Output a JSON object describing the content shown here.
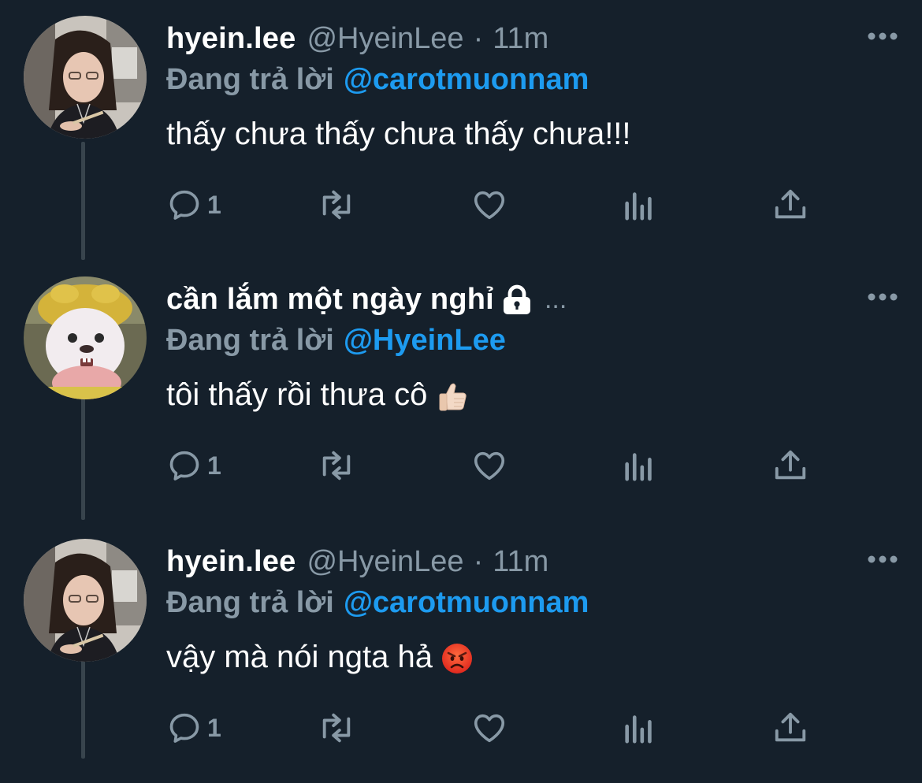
{
  "colors": {
    "background": "#15202b",
    "muted": "#8899a6",
    "mention": "#1d9bf0",
    "thread_line": "#38444d"
  },
  "tweets": [
    {
      "display_name": "hyein.lee",
      "handle": "@HyeinLee",
      "separator": "·",
      "time": "11m",
      "reply_prefix": "Đang trả lời",
      "reply_to": "@carotmuonnam",
      "text": "thấy chưa thấy chưa thấy chưa!!!",
      "reply_count": "1",
      "avatar": "avatar-photo-girl"
    },
    {
      "display_name": "cần lắm một ngày nghỉ",
      "protected_icon": "lock-icon",
      "name_truncation": "...",
      "reply_prefix": "Đang trả lời",
      "reply_to": "@HyeinLee",
      "text": "tôi thấy rồi thưa cô",
      "emoji": "thumbs-up-emoji",
      "reply_count": "1",
      "avatar": "avatar-toy-character"
    },
    {
      "display_name": "hyein.lee",
      "handle": "@HyeinLee",
      "separator": "·",
      "time": "11m",
      "reply_prefix": "Đang trả lời",
      "reply_to": "@carotmuonnam",
      "text": "vậy mà nói ngta hả",
      "emoji": "angry-face-emoji",
      "reply_count": "1",
      "avatar": "avatar-photo-girl"
    }
  ],
  "icons": [
    "reply-icon",
    "retweet-icon",
    "like-icon",
    "views-icon",
    "share-icon",
    "more-icon"
  ]
}
